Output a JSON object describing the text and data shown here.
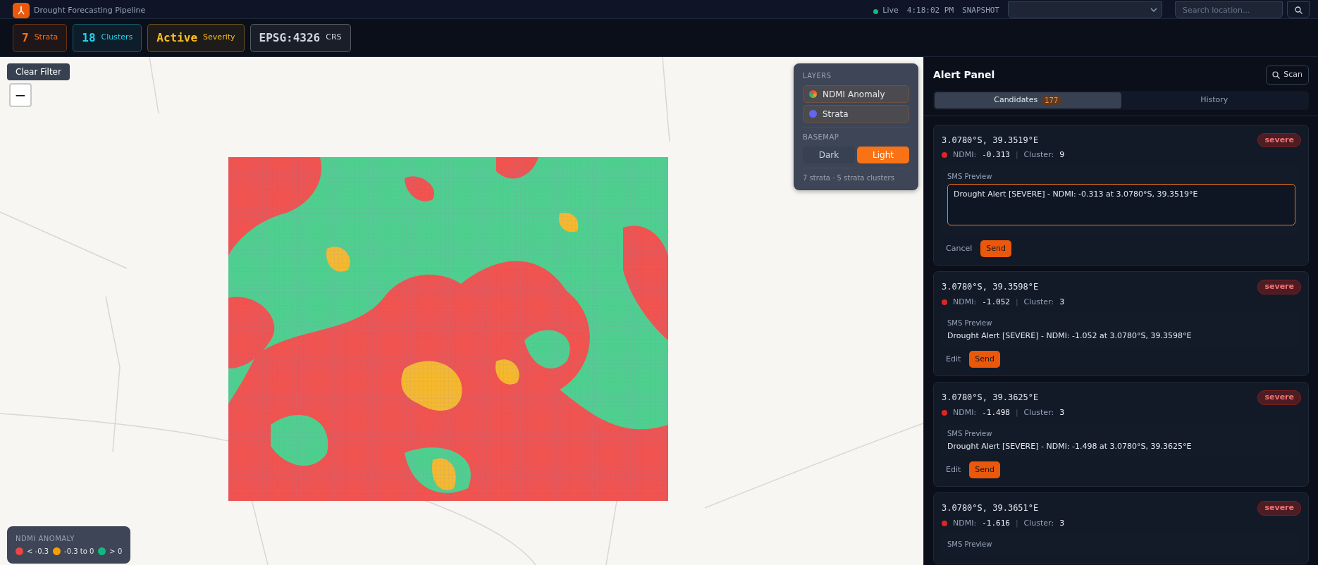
{
  "header": {
    "subtitle": "Drought Forecasting Pipeline",
    "live": {
      "label": "Live",
      "on": true
    },
    "time": "4:18:02 PM",
    "snapshot_label": "SNAPSHOT",
    "search": {
      "placeholder": "Search location..."
    }
  },
  "stats": [
    {
      "value": "7",
      "label": "Strata",
      "color": "#f97316"
    },
    {
      "value": "18",
      "label": "Clusters",
      "color": "#22d3ee"
    },
    {
      "value": "Active",
      "label": "Severity",
      "color": "#fbbf24"
    },
    {
      "value": "EPSG:4326",
      "label": "CRS",
      "color": "#cbd5e1"
    }
  ],
  "map": {
    "clear_filter": "Clear Filter",
    "zoom_out": "−",
    "layers": {
      "title": "LAYERS",
      "items": [
        {
          "label": "NDMI Anomaly",
          "kind": "gradient",
          "on": true
        },
        {
          "label": "Strata",
          "kind": "solid",
          "color": "#6366f1",
          "on": true
        }
      ]
    },
    "basemap": {
      "title": "BASEMAP",
      "options": [
        {
          "label": "Dark",
          "selected": false
        },
        {
          "label": "Light",
          "selected": true
        }
      ]
    },
    "summary": "7 strata · 5 strata clusters",
    "legend": {
      "title": "NDMI ANOMALY",
      "items": [
        {
          "label": "< -0.3",
          "color": "#ef4444"
        },
        {
          "label": "-0.3 to 0",
          "color": "#f59e0b"
        },
        {
          "label": "> 0",
          "color": "#10b981"
        }
      ]
    }
  },
  "alert_panel": {
    "title": "Alert Panel",
    "scan": "Scan",
    "tabs": [
      {
        "label": "Candidates",
        "count": "177",
        "selected": true
      },
      {
        "label": "History",
        "selected": false
      }
    ],
    "alerts": [
      {
        "kind": "editing",
        "coords": "3.0780°S, 39.3519°E",
        "severity": "severe",
        "color": "#dc2626",
        "ndmi_label": "NDMI:",
        "ndmi": "-0.313",
        "divider": "|",
        "cluster_label": "Cluster:",
        "cluster": "9",
        "sms_label": "SMS Preview",
        "message": "Drought Alert [SEVERE] - NDMI: -0.313 at 3.0780°S, 39.3519°E",
        "secondary": "Cancel",
        "send": "Send"
      },
      {
        "kind": "preview",
        "coords": "3.0780°S, 39.3598°E",
        "severity": "severe",
        "color": "#dc2626",
        "ndmi_label": "NDMI:",
        "ndmi": "-1.052",
        "divider": "|",
        "cluster_label": "Cluster:",
        "cluster": "3",
        "sms_label": "SMS Preview",
        "message": "Drought Alert [SEVERE] - NDMI: -1.052 at 3.0780°S, 39.3598°E",
        "secondary": "Edit",
        "send": "Send"
      },
      {
        "kind": "preview",
        "coords": "3.0780°S, 39.3625°E",
        "severity": "severe",
        "color": "#dc2626",
        "ndmi_label": "NDMI:",
        "ndmi": "-1.498",
        "divider": "|",
        "cluster_label": "Cluster:",
        "cluster": "3",
        "sms_label": "SMS Preview",
        "message": "Drought Alert [SEVERE] - NDMI: -1.498 at 3.0780°S, 39.3625°E",
        "secondary": "Edit",
        "send": "Send"
      },
      {
        "kind": "preview",
        "coords": "3.0780°S, 39.3651°E",
        "severity": "severe",
        "color": "#dc2626",
        "ndmi_label": "NDMI:",
        "ndmi": "-1.616",
        "divider": "|",
        "cluster_label": "Cluster:",
        "cluster": "3",
        "sms_label": "SMS Preview"
      }
    ]
  }
}
